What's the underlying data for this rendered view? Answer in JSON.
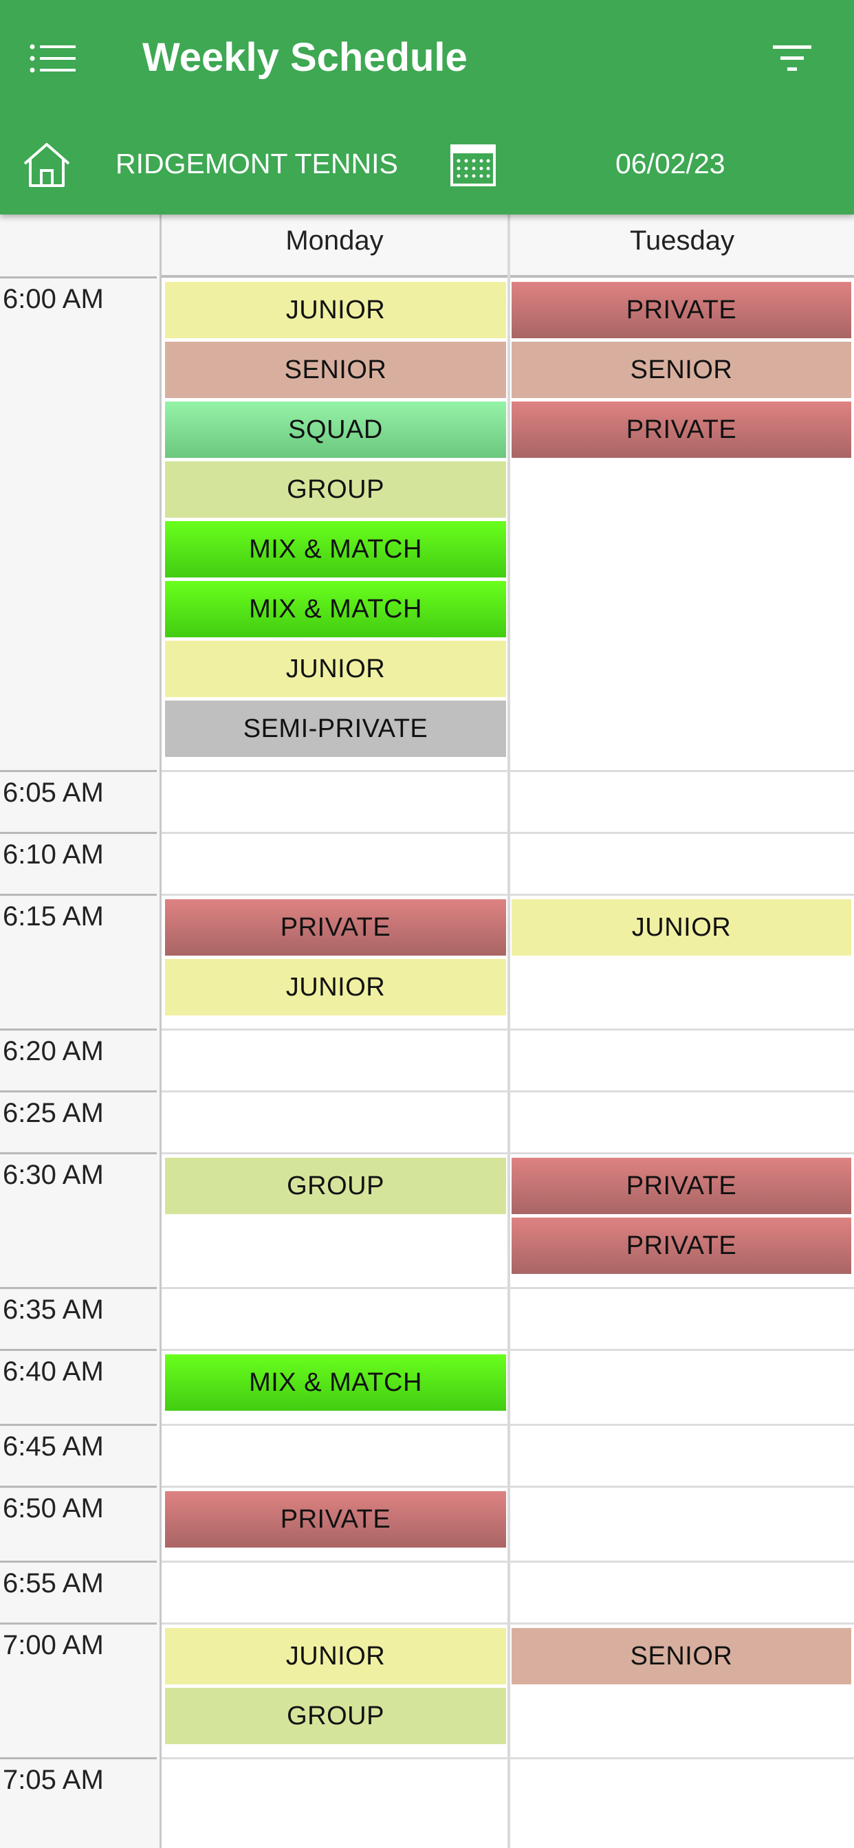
{
  "header": {
    "title": "Weekly Schedule",
    "club": "RIDGEMONT TENNIS",
    "date": "06/02/23",
    "icons": [
      "list-menu-icon",
      "filter-icon",
      "home-icon",
      "calendar-icon"
    ],
    "color": "#3ea853"
  },
  "days": [
    "Monday",
    "Tuesday"
  ],
  "times": [
    "6:00 AM",
    "6:05 AM",
    "6:10 AM",
    "6:15 AM",
    "6:20 AM",
    "6:25 AM",
    "6:30 AM",
    "6:35 AM",
    "6:40 AM",
    "6:45 AM",
    "6:50 AM",
    "6:55 AM",
    "7:00 AM",
    "7:05 AM"
  ],
  "slots": [
    {
      "time": "6:00 AM",
      "monday": [
        "JUNIOR",
        "SENIOR",
        "SQUAD",
        "GROUP",
        "MIX & MATCH",
        "MIX & MATCH",
        "JUNIOR",
        "SEMI-PRIVATE"
      ],
      "tuesday": [
        "PRIVATE",
        "SENIOR",
        "PRIVATE"
      ]
    },
    {
      "time": "6:05 AM",
      "monday": [],
      "tuesday": []
    },
    {
      "time": "6:10 AM",
      "monday": [],
      "tuesday": []
    },
    {
      "time": "6:15 AM",
      "monday": [
        "PRIVATE",
        "JUNIOR"
      ],
      "tuesday": [
        "JUNIOR"
      ]
    },
    {
      "time": "6:20 AM",
      "monday": [],
      "tuesday": []
    },
    {
      "time": "6:25 AM",
      "monday": [],
      "tuesday": []
    },
    {
      "time": "6:30 AM",
      "monday": [
        "GROUP"
      ],
      "tuesday": [
        "PRIVATE",
        "PRIVATE"
      ]
    },
    {
      "time": "6:35 AM",
      "monday": [],
      "tuesday": []
    },
    {
      "time": "6:40 AM",
      "monday": [
        "MIX & MATCH"
      ],
      "tuesday": []
    },
    {
      "time": "6:45 AM",
      "monday": [],
      "tuesday": []
    },
    {
      "time": "6:50 AM",
      "monday": [
        "PRIVATE"
      ],
      "tuesday": []
    },
    {
      "time": "6:55 AM",
      "monday": [],
      "tuesday": []
    },
    {
      "time": "7:00 AM",
      "monday": [
        "JUNIOR",
        "GROUP"
      ],
      "tuesday": [
        "SENIOR"
      ]
    },
    {
      "time": "7:05 AM",
      "monday": [],
      "tuesday": []
    }
  ],
  "category_colors": {
    "JUNIOR": "#f0f0a2",
    "SENIOR": "#d8af9e",
    "SQUAD": "#7fdc91",
    "GROUP": "#d5e49b",
    "MIX & MATCH": "#55e818",
    "SEMI-PRIVATE": "#bfbfbf",
    "PRIVATE": "#c57474"
  }
}
